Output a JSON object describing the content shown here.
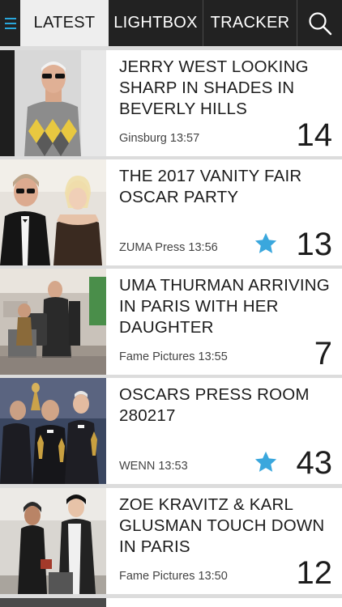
{
  "nav": {
    "menu_icon": "hamburger-menu-icon",
    "tabs": [
      {
        "label": "LATEST",
        "active": true
      },
      {
        "label": "LIGHTBOX",
        "active": false
      },
      {
        "label": "TRACKER",
        "active": false
      }
    ],
    "search_icon": "search-icon",
    "accent_color": "#29a7dc"
  },
  "stories": [
    {
      "title": "JERRY WEST LOOKING SHARP IN SHADES IN BEVERLY HILLS",
      "source": "Ginsburg",
      "time": "13:57",
      "count": "14",
      "starred": false
    },
    {
      "title": "THE 2017 VANITY FAIR OSCAR PARTY",
      "source": "ZUMA Press",
      "time": "13:56",
      "count": "13",
      "starred": true
    },
    {
      "title": "UMA THURMAN ARRIVING IN PARIS WITH HER DAUGHTER",
      "source": "Fame Pictures",
      "time": "13:55",
      "count": "7",
      "starred": false
    },
    {
      "title": "OSCARS PRESS ROOM 280217",
      "source": "WENN",
      "time": "13:53",
      "count": "43",
      "starred": true
    },
    {
      "title": "ZOE KRAVITZ & KARL GLUSMAN TOUCH DOWN IN PARIS",
      "source": "Fame Pictures",
      "time": "13:50",
      "count": "12",
      "starred": false
    }
  ],
  "star_color": "#3aa7dd"
}
